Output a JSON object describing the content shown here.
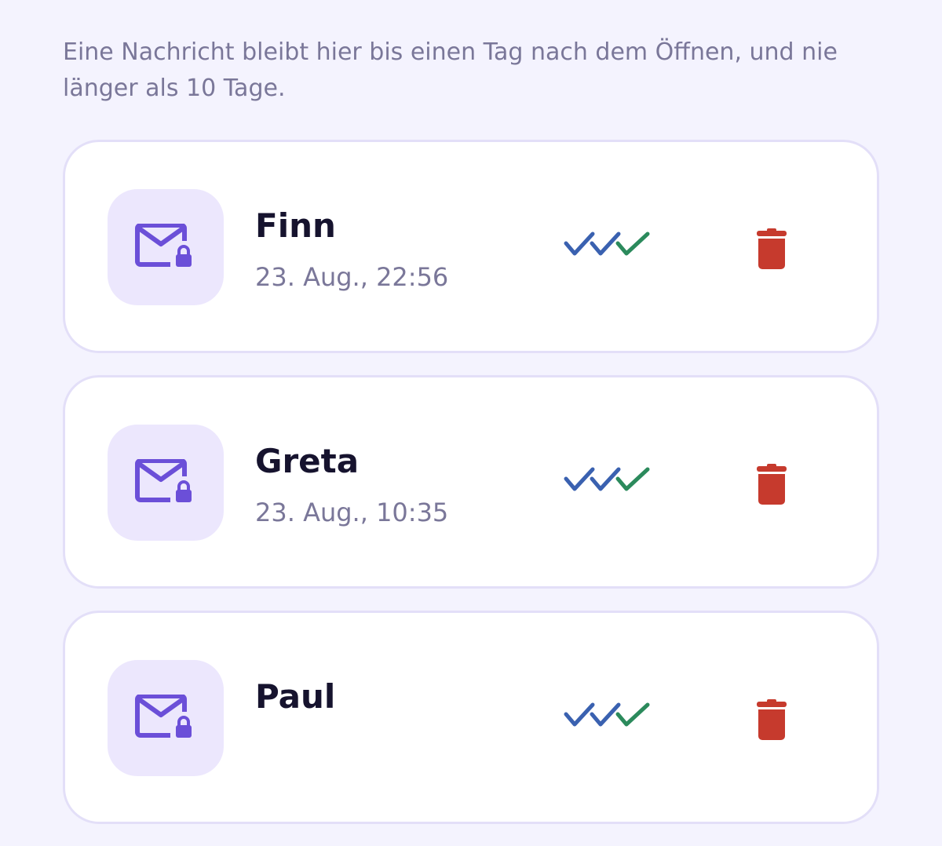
{
  "info": {
    "text": "Eine Nachricht bleibt hier bis einen Tag nach dem Öffnen, und nie länger als 10 Tage."
  },
  "messages": [
    {
      "sender": "Finn",
      "time": "23. Aug., 22:56"
    },
    {
      "sender": "Greta",
      "time": "23. Aug., 10:35"
    },
    {
      "sender": "Paul",
      "time": ""
    }
  ],
  "icons": {
    "envelope": "locked-envelope-icon",
    "status": "triple-check-icon",
    "delete": "trash-icon"
  },
  "colors": {
    "background": "#f4f3fe",
    "card": "#ffffff",
    "card_border": "#e3dff8",
    "icon_tile": "#ece7fd",
    "accent": "#6b4fd8",
    "check_blue": "#3a61b0",
    "check_green": "#2b8a5c",
    "delete_red": "#c63a2d",
    "title": "#16132e",
    "muted": "#7a7799"
  }
}
